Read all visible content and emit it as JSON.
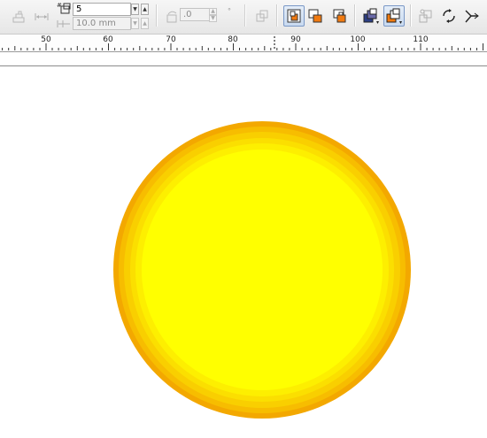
{
  "toolbar": {
    "steps_value": "5",
    "offset_value": "10.0 mm",
    "rotation_value": ".0",
    "degree_symbol": "°",
    "spin_up": "▲",
    "spin_down": "▼",
    "icons": {
      "mode": "contour-to-center-icon",
      "steps": "contour-steps-icon",
      "offset": "contour-offset-icon"
    }
  },
  "ruler": {
    "labels": [
      "50",
      "60",
      "70",
      "80",
      "90",
      "100",
      "110"
    ],
    "start_value": 43.5,
    "end_value": 121.5
  },
  "contour": {
    "outer_color": "#f3a800",
    "inner_color": "#ffff00",
    "steps": 5
  }
}
